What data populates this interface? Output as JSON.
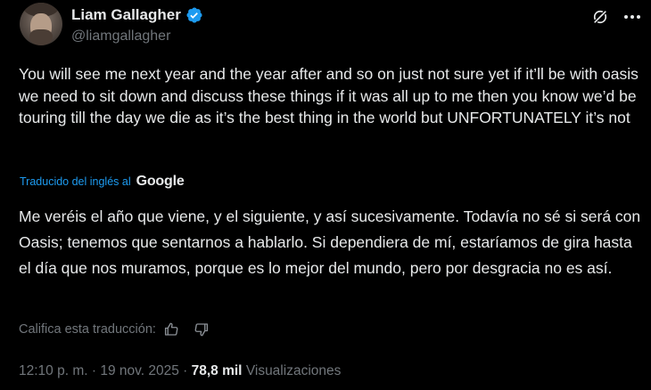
{
  "author": {
    "display_name": "Liam Gallagher",
    "handle": "@liamgallagher"
  },
  "tweet": {
    "text": "You will see me next year and the year after and so on just not sure yet if it’ll be with oasis we need to sit down and discuss these things if it was all up to me then you know we’d be touring till the day we die as it’s the best thing in the world but UNFORTUNATELY it’s not"
  },
  "translation": {
    "label": "Traducido del inglés al",
    "provider": "Google",
    "text": "Me veréis el año que viene, y el siguiente, y así sucesivamente. Todavía no sé si será con Oasis; tenemos que sentarnos a hablarlo. Si dependiera de mí, estaríamos de gira hasta el día que nos muramos, porque es lo mejor del mundo, pero por desgracia no es así.",
    "rate_label": "Califica esta traducción:"
  },
  "meta": {
    "time": "12:10 p. m.",
    "separator": "·",
    "date": "19 nov. 2025",
    "views_count": "78,8 mil",
    "views_label": "Visualizaciones"
  },
  "icons": {
    "verified": "verified-badge-icon",
    "grok": "grok-icon",
    "more": "more-icon",
    "thumbs_up": "thumbs-up-icon",
    "thumbs_down": "thumbs-down-icon"
  },
  "colors": {
    "background": "#000000",
    "text": "#e7e9ea",
    "muted": "#71767b",
    "link": "#1d9bf0",
    "verified": "#1d9bf0"
  }
}
